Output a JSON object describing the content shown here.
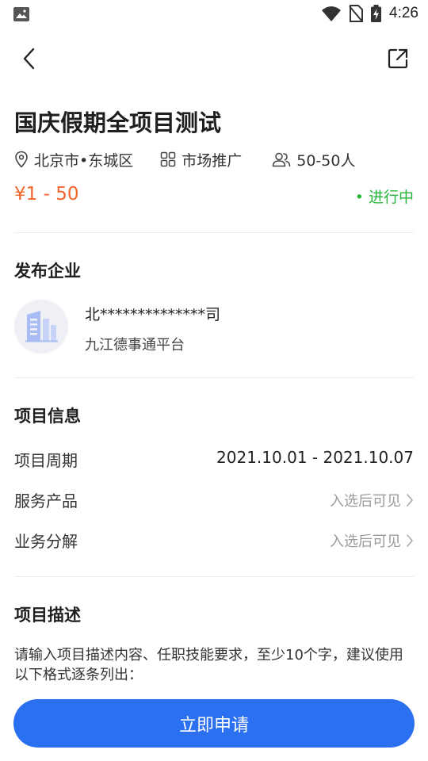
{
  "status_bar": {
    "time": "4:26"
  },
  "project": {
    "title": "国庆假期全项目测试",
    "location": "北京市•东城区",
    "category": "市场推广",
    "headcount": "50-50人",
    "price": "¥1 - 50",
    "status": "• 进行中"
  },
  "company": {
    "section_title": "发布企业",
    "name": "北**************司",
    "platform": "九江德事通平台"
  },
  "info": {
    "section_title": "项目信息",
    "rows": [
      {
        "label": "项目周期",
        "value": "2021.10.01 - 2021.10.07"
      },
      {
        "label": "服务产品",
        "value": "入选后可见"
      },
      {
        "label": "业务分解",
        "value": "入选后可见"
      }
    ]
  },
  "description": {
    "section_title": "项目描述",
    "text": "请输入项目描述内容、任职技能要求，至少10个字，建议使用以下格式逐条列出："
  },
  "apply_button": {
    "label": "立即申请"
  },
  "colors": {
    "accent": "#2b70f0",
    "price": "#f2662b",
    "status": "#27b53a"
  }
}
